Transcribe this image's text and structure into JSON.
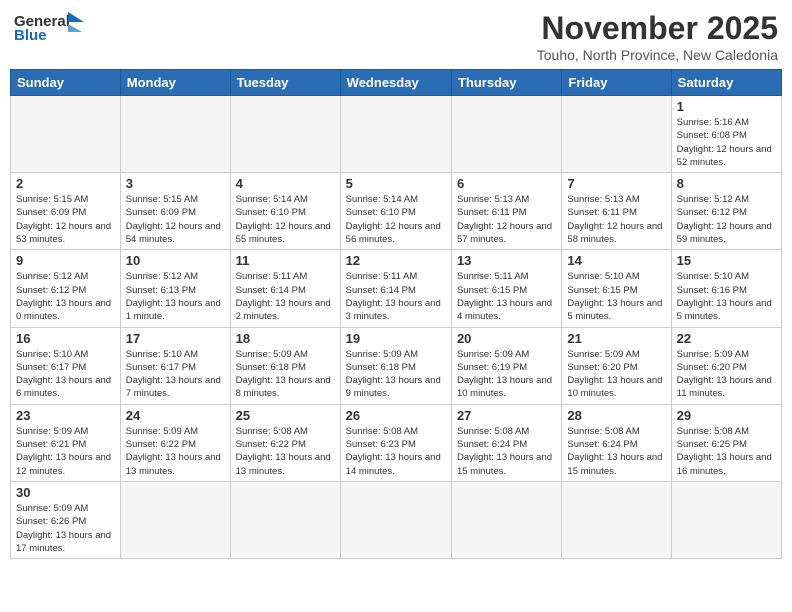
{
  "header": {
    "logo_general": "General",
    "logo_blue": "Blue",
    "month_title": "November 2025",
    "location": "Touho, North Province, New Caledonia"
  },
  "weekdays": [
    "Sunday",
    "Monday",
    "Tuesday",
    "Wednesday",
    "Thursday",
    "Friday",
    "Saturday"
  ],
  "weeks": [
    [
      {
        "day": "",
        "info": ""
      },
      {
        "day": "",
        "info": ""
      },
      {
        "day": "",
        "info": ""
      },
      {
        "day": "",
        "info": ""
      },
      {
        "day": "",
        "info": ""
      },
      {
        "day": "",
        "info": ""
      },
      {
        "day": "1",
        "info": "Sunrise: 5:16 AM\nSunset: 6:08 PM\nDaylight: 12 hours\nand 52 minutes."
      }
    ],
    [
      {
        "day": "2",
        "info": "Sunrise: 5:15 AM\nSunset: 6:09 PM\nDaylight: 12 hours\nand 53 minutes."
      },
      {
        "day": "3",
        "info": "Sunrise: 5:15 AM\nSunset: 6:09 PM\nDaylight: 12 hours\nand 54 minutes."
      },
      {
        "day": "4",
        "info": "Sunrise: 5:14 AM\nSunset: 6:10 PM\nDaylight: 12 hours\nand 55 minutes."
      },
      {
        "day": "5",
        "info": "Sunrise: 5:14 AM\nSunset: 6:10 PM\nDaylight: 12 hours\nand 56 minutes."
      },
      {
        "day": "6",
        "info": "Sunrise: 5:13 AM\nSunset: 6:11 PM\nDaylight: 12 hours\nand 57 minutes."
      },
      {
        "day": "7",
        "info": "Sunrise: 5:13 AM\nSunset: 6:11 PM\nDaylight: 12 hours\nand 58 minutes."
      },
      {
        "day": "8",
        "info": "Sunrise: 5:12 AM\nSunset: 6:12 PM\nDaylight: 12 hours\nand 59 minutes."
      }
    ],
    [
      {
        "day": "9",
        "info": "Sunrise: 5:12 AM\nSunset: 6:12 PM\nDaylight: 13 hours\nand 0 minutes."
      },
      {
        "day": "10",
        "info": "Sunrise: 5:12 AM\nSunset: 6:13 PM\nDaylight: 13 hours\nand 1 minute."
      },
      {
        "day": "11",
        "info": "Sunrise: 5:11 AM\nSunset: 6:14 PM\nDaylight: 13 hours\nand 2 minutes."
      },
      {
        "day": "12",
        "info": "Sunrise: 5:11 AM\nSunset: 6:14 PM\nDaylight: 13 hours\nand 3 minutes."
      },
      {
        "day": "13",
        "info": "Sunrise: 5:11 AM\nSunset: 6:15 PM\nDaylight: 13 hours\nand 4 minutes."
      },
      {
        "day": "14",
        "info": "Sunrise: 5:10 AM\nSunset: 6:15 PM\nDaylight: 13 hours\nand 5 minutes."
      },
      {
        "day": "15",
        "info": "Sunrise: 5:10 AM\nSunset: 6:16 PM\nDaylight: 13 hours\nand 5 minutes."
      }
    ],
    [
      {
        "day": "16",
        "info": "Sunrise: 5:10 AM\nSunset: 6:17 PM\nDaylight: 13 hours\nand 6 minutes."
      },
      {
        "day": "17",
        "info": "Sunrise: 5:10 AM\nSunset: 6:17 PM\nDaylight: 13 hours\nand 7 minutes."
      },
      {
        "day": "18",
        "info": "Sunrise: 5:09 AM\nSunset: 6:18 PM\nDaylight: 13 hours\nand 8 minutes."
      },
      {
        "day": "19",
        "info": "Sunrise: 5:09 AM\nSunset: 6:18 PM\nDaylight: 13 hours\nand 9 minutes."
      },
      {
        "day": "20",
        "info": "Sunrise: 5:09 AM\nSunset: 6:19 PM\nDaylight: 13 hours\nand 10 minutes."
      },
      {
        "day": "21",
        "info": "Sunrise: 5:09 AM\nSunset: 6:20 PM\nDaylight: 13 hours\nand 10 minutes."
      },
      {
        "day": "22",
        "info": "Sunrise: 5:09 AM\nSunset: 6:20 PM\nDaylight: 13 hours\nand 11 minutes."
      }
    ],
    [
      {
        "day": "23",
        "info": "Sunrise: 5:09 AM\nSunset: 6:21 PM\nDaylight: 13 hours\nand 12 minutes."
      },
      {
        "day": "24",
        "info": "Sunrise: 5:09 AM\nSunset: 6:22 PM\nDaylight: 13 hours\nand 13 minutes."
      },
      {
        "day": "25",
        "info": "Sunrise: 5:08 AM\nSunset: 6:22 PM\nDaylight: 13 hours\nand 13 minutes."
      },
      {
        "day": "26",
        "info": "Sunrise: 5:08 AM\nSunset: 6:23 PM\nDaylight: 13 hours\nand 14 minutes."
      },
      {
        "day": "27",
        "info": "Sunrise: 5:08 AM\nSunset: 6:24 PM\nDaylight: 13 hours\nand 15 minutes."
      },
      {
        "day": "28",
        "info": "Sunrise: 5:08 AM\nSunset: 6:24 PM\nDaylight: 13 hours\nand 15 minutes."
      },
      {
        "day": "29",
        "info": "Sunrise: 5:08 AM\nSunset: 6:25 PM\nDaylight: 13 hours\nand 16 minutes."
      }
    ],
    [
      {
        "day": "30",
        "info": "Sunrise: 5:09 AM\nSunset: 6:26 PM\nDaylight: 13 hours\nand 17 minutes."
      },
      {
        "day": "",
        "info": ""
      },
      {
        "day": "",
        "info": ""
      },
      {
        "day": "",
        "info": ""
      },
      {
        "day": "",
        "info": ""
      },
      {
        "day": "",
        "info": ""
      },
      {
        "day": "",
        "info": ""
      }
    ]
  ]
}
